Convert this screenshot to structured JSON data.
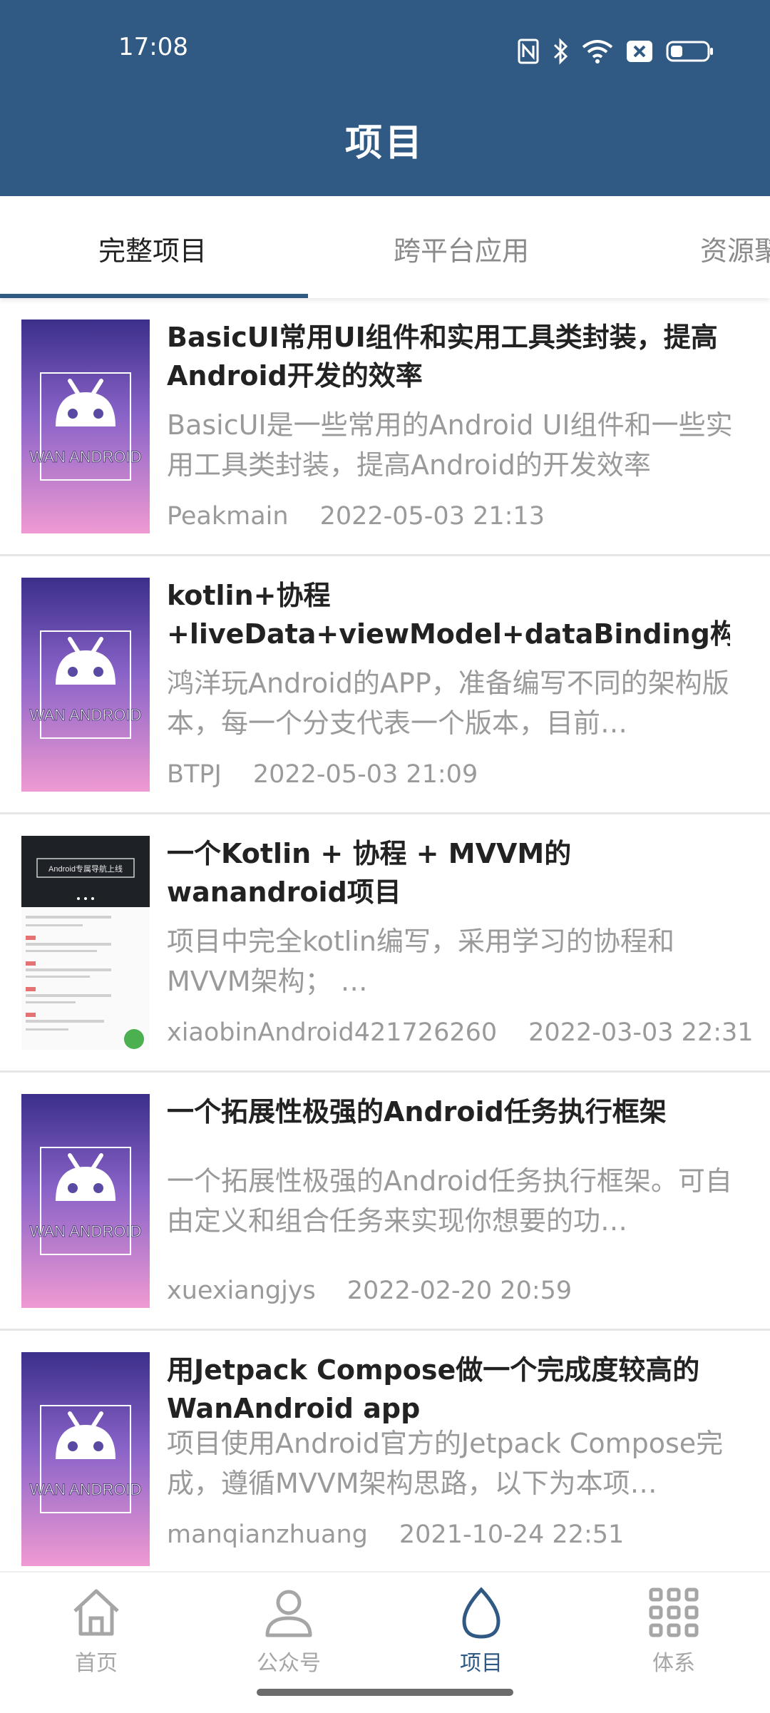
{
  "status_bar": {
    "time": "17:08"
  },
  "header": {
    "title": "项目"
  },
  "tabs": [
    {
      "label": "完整项目",
      "active": true
    },
    {
      "label": "跨平台应用",
      "active": false
    },
    {
      "label": "资源聚合类",
      "active": false
    }
  ],
  "thumb_text": "WAN ANDROID",
  "thumb3_text": "Android专属导航上线",
  "items": [
    {
      "title": "BasicUI常用UI组件和实用工具类封装，提高Android开发的效率",
      "desc": "BasicUI是一些常用的Android UI组件和一些实用工具类封装，提高Android的开发效率",
      "author": "Peakmain",
      "date": "2022-05-03 21:13"
    },
    {
      "title": "kotlin+协程+liveData+viewModel+dataBinding构造…",
      "desc": "鸿洋玩Android的APP，准备编写不同的架构版本，每一个分支代表一个版本，目前…",
      "author": "BTPJ",
      "date": "2022-05-03 21:09"
    },
    {
      "title": "一个Kotlin + 协程 + MVVM的wanandroid项目",
      "desc": "项目中完全kotlin编写，采用学习的协程和MVVM架构； …",
      "author": "xiaobinAndroid421726260",
      "date": "2022-03-03 22:31"
    },
    {
      "title": "一个拓展性极强的Android任务执行框架",
      "desc": "一个拓展性极强的Android任务执行框架。可自由定义和组合任务来实现你想要的功…",
      "author": "xuexiangjys",
      "date": "2022-02-20 20:59"
    },
    {
      "title": "用Jetpack Compose做一个完成度较高的WanAndroid app",
      "desc": "项目使用Android官方的Jetpack Compose完成，遵循MVVM架构思路，以下为本项…",
      "author": "manqianzhuang",
      "date": "2021-10-24 22:51"
    }
  ],
  "bottom_nav": [
    {
      "label": "首页",
      "icon": "home-icon",
      "active": false
    },
    {
      "label": "公众号",
      "icon": "person-icon",
      "active": false
    },
    {
      "label": "项目",
      "icon": "egg-icon",
      "active": true
    },
    {
      "label": "体系",
      "icon": "grid-icon",
      "active": false
    }
  ],
  "colors": {
    "primary": "#305a84",
    "inactive": "#a6a6a6",
    "text_secondary": "#9a9a9a"
  }
}
